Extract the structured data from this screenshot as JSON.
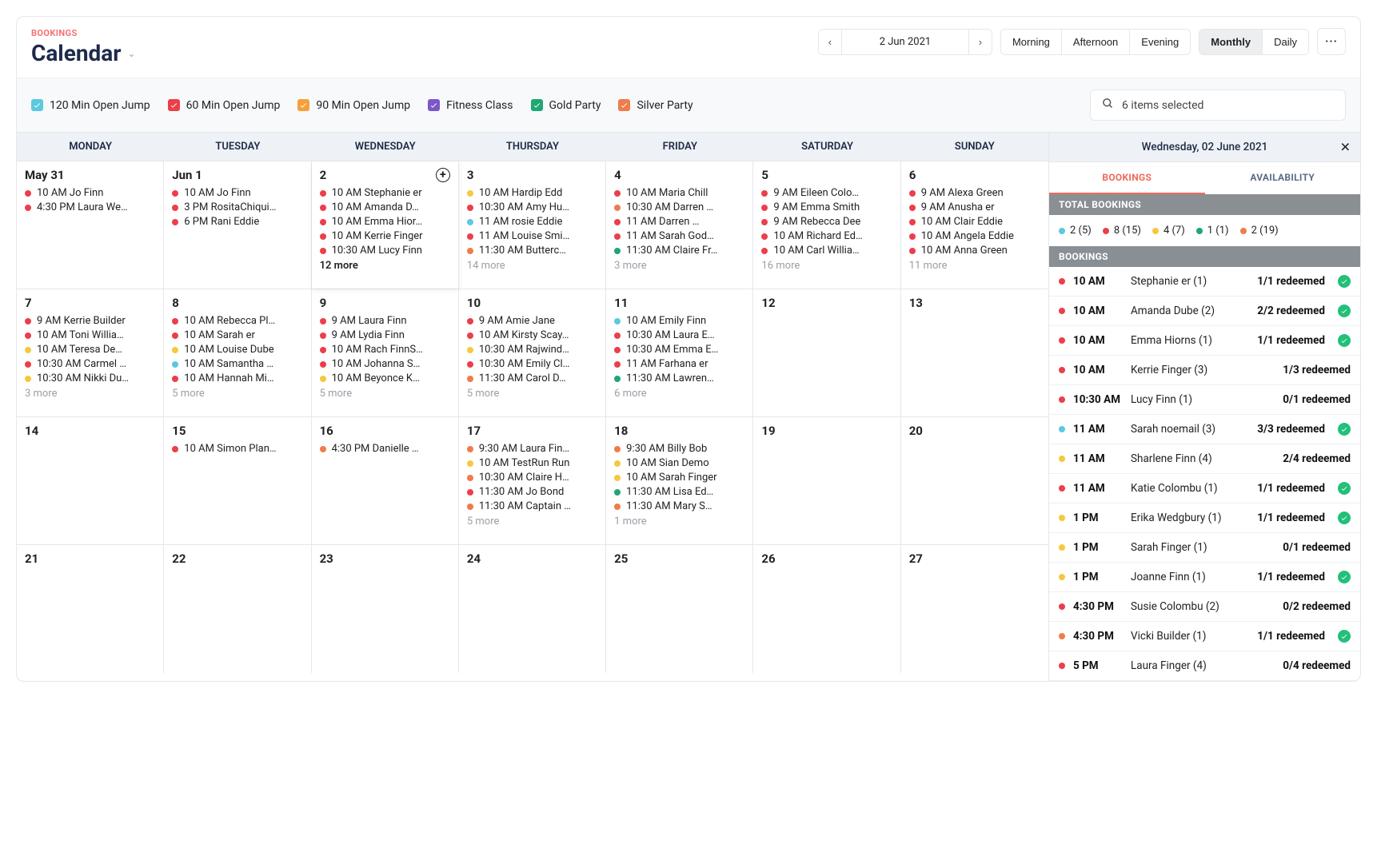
{
  "section_label": "BOOKINGS",
  "page_title": "Calendar",
  "date_display": "2 Jun 2021",
  "timeOfDay": [
    "Morning",
    "Afternoon",
    "Evening"
  ],
  "viewModes": [
    "Monthly",
    "Daily"
  ],
  "activeViewMode": "Monthly",
  "legend": [
    {
      "label": "120 Min Open Jump",
      "color": "c-cyan"
    },
    {
      "label": "60 Min Open Jump",
      "color": "c-red"
    },
    {
      "label": "90 Min Open Jump",
      "color": "c-orange"
    },
    {
      "label": "Fitness Class",
      "color": "c-purple"
    },
    {
      "label": "Gold Party",
      "color": "c-green"
    },
    {
      "label": "Silver Party",
      "color": "c-coral"
    }
  ],
  "search_text": "6 items selected",
  "weekday_labels": [
    "MONDAY",
    "TUESDAY",
    "WEDNESDAY",
    "THURSDAY",
    "FRIDAY",
    "SATURDAY",
    "SUNDAY"
  ],
  "weeks": [
    [
      {
        "num": "May 31",
        "events": [
          {
            "c": "c-red",
            "t": "10 AM Jo Finn"
          },
          {
            "c": "c-red",
            "t": "4:30 PM Laura We…"
          }
        ]
      },
      {
        "num": "Jun 1",
        "events": [
          {
            "c": "c-red",
            "t": "10 AM Jo Finn"
          },
          {
            "c": "c-red",
            "t": "3 PM RositaChiqui…"
          },
          {
            "c": "c-red",
            "t": "6 PM Rani Eddie"
          }
        ]
      },
      {
        "num": "2",
        "selected": true,
        "add": true,
        "moreStrong": "12 more",
        "events": [
          {
            "c": "c-red",
            "t": "10 AM Stephanie er"
          },
          {
            "c": "c-red",
            "t": "10 AM Amanda D…"
          },
          {
            "c": "c-red",
            "t": "10 AM Emma Hior…"
          },
          {
            "c": "c-red",
            "t": "10 AM Kerrie Finger"
          },
          {
            "c": "c-red",
            "t": "10:30 AM Lucy Finn"
          }
        ]
      },
      {
        "num": "3",
        "more": "14 more",
        "events": [
          {
            "c": "c-yellow",
            "t": "10 AM Hardip Edd"
          },
          {
            "c": "c-red",
            "t": "10:30 AM Amy Hu…"
          },
          {
            "c": "c-cyan",
            "t": "11 AM rosie Eddie"
          },
          {
            "c": "c-red",
            "t": "11 AM Louise Smi…"
          },
          {
            "c": "c-coral",
            "t": "11:30 AM Butterc…"
          }
        ]
      },
      {
        "num": "4",
        "more": "3 more",
        "events": [
          {
            "c": "c-red",
            "t": "10 AM Maria Chill"
          },
          {
            "c": "c-coral",
            "t": "10:30 AM Darren …"
          },
          {
            "c": "c-red",
            "t": "11 AM Darren …"
          },
          {
            "c": "c-red",
            "t": "11 AM Sarah God…"
          },
          {
            "c": "c-green",
            "t": "11:30 AM Claire Fr…"
          }
        ]
      },
      {
        "num": "5",
        "more": "16 more",
        "events": [
          {
            "c": "c-red",
            "t": "9 AM Eileen Colo…"
          },
          {
            "c": "c-red",
            "t": "9 AM Emma Smith"
          },
          {
            "c": "c-red",
            "t": "9 AM Rebecca Dee"
          },
          {
            "c": "c-red",
            "t": "10 AM Richard Ed…"
          },
          {
            "c": "c-red",
            "t": "10 AM Carl Willia…"
          }
        ]
      },
      {
        "num": "6",
        "more": "11 more",
        "events": [
          {
            "c": "c-red",
            "t": "9 AM Alexa Green"
          },
          {
            "c": "c-red",
            "t": "9 AM Anusha er"
          },
          {
            "c": "c-red",
            "t": "10 AM Clair Eddie"
          },
          {
            "c": "c-red",
            "t": "10 AM Angela Eddie"
          },
          {
            "c": "c-red",
            "t": "10 AM Anna Green"
          }
        ]
      }
    ],
    [
      {
        "num": "7",
        "more": "3 more",
        "events": [
          {
            "c": "c-red",
            "t": "9 AM Kerrie Builder"
          },
          {
            "c": "c-red",
            "t": "10 AM Toni Willia…"
          },
          {
            "c": "c-yellow",
            "t": "10 AM Teresa De…"
          },
          {
            "c": "c-red",
            "t": "10:30 AM Carmel …"
          },
          {
            "c": "c-yellow",
            "t": "10:30 AM Nikki Du…"
          }
        ]
      },
      {
        "num": "8",
        "more": "5 more",
        "events": [
          {
            "c": "c-red",
            "t": "10 AM Rebecca Pl…"
          },
          {
            "c": "c-red",
            "t": "10 AM Sarah er"
          },
          {
            "c": "c-yellow",
            "t": "10 AM Louise Dube"
          },
          {
            "c": "c-cyan",
            "t": "10 AM Samantha …"
          },
          {
            "c": "c-red",
            "t": "10 AM Hannah Mi…"
          }
        ]
      },
      {
        "num": "9",
        "more": "5 more",
        "events": [
          {
            "c": "c-red",
            "t": "9 AM Laura Finn"
          },
          {
            "c": "c-red",
            "t": "9 AM Lydia Finn"
          },
          {
            "c": "c-red",
            "t": "10 AM Rach FinnS…"
          },
          {
            "c": "c-red",
            "t": "10 AM Johanna S…"
          },
          {
            "c": "c-yellow",
            "t": "10 AM Beyonce K…"
          }
        ]
      },
      {
        "num": "10",
        "more": "5 more",
        "events": [
          {
            "c": "c-red",
            "t": "9 AM Amie Jane"
          },
          {
            "c": "c-red",
            "t": "10 AM Kirsty Scay…"
          },
          {
            "c": "c-yellow",
            "t": "10:30 AM Rajwind…"
          },
          {
            "c": "c-red",
            "t": "10:30 AM Emily Cl…"
          },
          {
            "c": "c-coral",
            "t": "11:30 AM Carol D…"
          }
        ]
      },
      {
        "num": "11",
        "more": "6 more",
        "events": [
          {
            "c": "c-cyan",
            "t": "10 AM Emily Finn"
          },
          {
            "c": "c-red",
            "t": "10:30 AM Laura E…"
          },
          {
            "c": "c-red",
            "t": "10:30 AM Emma E…"
          },
          {
            "c": "c-red",
            "t": "11 AM Farhana er"
          },
          {
            "c": "c-green",
            "t": "11:30 AM Lawren…"
          }
        ]
      },
      {
        "num": "12",
        "events": []
      },
      {
        "num": "13",
        "events": []
      }
    ],
    [
      {
        "num": "14",
        "events": []
      },
      {
        "num": "15",
        "events": [
          {
            "c": "c-red",
            "t": "10 AM Simon Plan…"
          }
        ]
      },
      {
        "num": "16",
        "events": [
          {
            "c": "c-coral",
            "t": "4:30 PM Danielle …"
          }
        ]
      },
      {
        "num": "17",
        "more": "5 more",
        "events": [
          {
            "c": "c-coral",
            "t": "9:30 AM Laura Fin…"
          },
          {
            "c": "c-yellow",
            "t": "10 AM TestRun Run"
          },
          {
            "c": "c-coral",
            "t": "10:30 AM Claire H…"
          },
          {
            "c": "c-red",
            "t": "11:30 AM Jo Bond"
          },
          {
            "c": "c-coral",
            "t": "11:30 AM Captain …"
          }
        ]
      },
      {
        "num": "18",
        "more": "1 more",
        "events": [
          {
            "c": "c-coral",
            "t": "9:30 AM Billy Bob"
          },
          {
            "c": "c-yellow",
            "t": "10 AM Sian Demo"
          },
          {
            "c": "c-yellow",
            "t": "10 AM Sarah Finger"
          },
          {
            "c": "c-green",
            "t": "11:30 AM Lisa Ed…"
          },
          {
            "c": "c-coral",
            "t": "11:30 AM Mary S…"
          }
        ]
      },
      {
        "num": "19",
        "events": []
      },
      {
        "num": "20",
        "events": []
      }
    ],
    [
      {
        "num": "21",
        "events": []
      },
      {
        "num": "22",
        "events": []
      },
      {
        "num": "23",
        "events": []
      },
      {
        "num": "24",
        "events": []
      },
      {
        "num": "25",
        "events": []
      },
      {
        "num": "26",
        "events": []
      },
      {
        "num": "27",
        "events": []
      }
    ]
  ],
  "side": {
    "title": "Wednesday, 02 June 2021",
    "tabs": [
      "BOOKINGS",
      "AVAILABILITY"
    ],
    "total_label": "TOTAL BOOKINGS",
    "bookings_label": "BOOKINGS",
    "totals": [
      {
        "c": "c-cyan",
        "t": "2 (5)"
      },
      {
        "c": "c-red",
        "t": "8 (15)"
      },
      {
        "c": "c-yellow",
        "t": "4 (7)"
      },
      {
        "c": "c-green",
        "t": "1 (1)"
      },
      {
        "c": "c-coral",
        "t": "2 (19)"
      }
    ],
    "rows": [
      {
        "c": "c-red",
        "time": "10 AM",
        "name": "Stephanie er (1)",
        "status": "1/1 redeemed",
        "check": true
      },
      {
        "c": "c-red",
        "time": "10 AM",
        "name": "Amanda Dube (2)",
        "status": "2/2 redeemed",
        "check": true
      },
      {
        "c": "c-red",
        "time": "10 AM",
        "name": "Emma Hiorns (1)",
        "status": "1/1 redeemed",
        "check": true
      },
      {
        "c": "c-red",
        "time": "10 AM",
        "name": "Kerrie Finger (3)",
        "status": "1/3 redeemed",
        "check": false
      },
      {
        "c": "c-red",
        "time": "10:30 AM",
        "name": "Lucy Finn (1)",
        "status": "0/1 redeemed",
        "check": false
      },
      {
        "c": "c-cyan",
        "time": "11 AM",
        "name": "Sarah noemail (3)",
        "status": "3/3 redeemed",
        "check": true
      },
      {
        "c": "c-yellow",
        "time": "11 AM",
        "name": "Sharlene Finn (4)",
        "status": "2/4 redeemed",
        "check": false
      },
      {
        "c": "c-red",
        "time": "11 AM",
        "name": "Katie Colombu (1)",
        "status": "1/1 redeemed",
        "check": true
      },
      {
        "c": "c-yellow",
        "time": "1 PM",
        "name": "Erika Wedgbury (1)",
        "status": "1/1 redeemed",
        "check": true
      },
      {
        "c": "c-yellow",
        "time": "1 PM",
        "name": "Sarah Finger (1)",
        "status": "0/1 redeemed",
        "check": false
      },
      {
        "c": "c-yellow",
        "time": "1 PM",
        "name": "Joanne Finn (1)",
        "status": "1/1 redeemed",
        "check": true
      },
      {
        "c": "c-red",
        "time": "4:30 PM",
        "name": "Susie Colombu (2)",
        "status": "0/2 redeemed",
        "check": false
      },
      {
        "c": "c-coral",
        "time": "4:30 PM",
        "name": "Vicki Builder (1)",
        "status": "1/1 redeemed",
        "check": true
      },
      {
        "c": "c-red",
        "time": "5 PM",
        "name": "Laura Finger (4)",
        "status": "0/4 redeemed",
        "check": false
      }
    ]
  }
}
